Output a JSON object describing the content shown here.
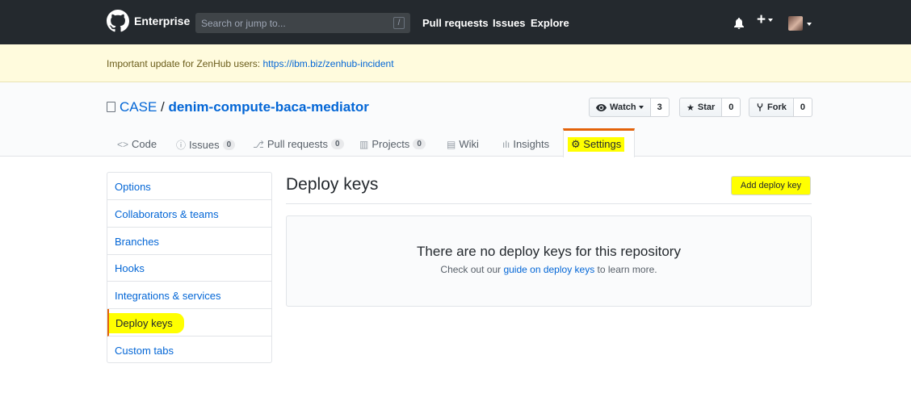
{
  "header": {
    "brand": "Enterprise",
    "search_placeholder": "Search or jump to...",
    "slash_hint": "/",
    "nav": [
      "Pull requests",
      "Issues",
      "Explore"
    ],
    "plus": "+"
  },
  "banner": {
    "text": "Important update for ZenHub users: ",
    "link": "https://ibm.biz/zenhub-incident"
  },
  "repo": {
    "owner": "CASE",
    "separator": " / ",
    "name": "denim-compute-baca-mediator",
    "watch_label": "Watch",
    "watch_count": "3",
    "star_label": "Star",
    "star_count": "0",
    "fork_label": "Fork",
    "fork_count": "0"
  },
  "tabs": {
    "code": "Code",
    "issues": "Issues",
    "issues_count": "0",
    "pulls": "Pull requests",
    "pulls_count": "0",
    "projects": "Projects",
    "projects_count": "0",
    "wiki": "Wiki",
    "insights": "Insights",
    "settings": "Settings"
  },
  "sidebar": {
    "items": [
      {
        "label": "Options"
      },
      {
        "label": "Collaborators & teams"
      },
      {
        "label": "Branches"
      },
      {
        "label": "Hooks"
      },
      {
        "label": "Integrations & services"
      },
      {
        "label": "Deploy keys"
      },
      {
        "label": "Custom tabs"
      }
    ]
  },
  "main": {
    "title": "Deploy keys",
    "add_button": "Add deploy key",
    "blank_heading": "There are no deploy keys for this repository",
    "blank_text_before": "Check out our ",
    "blank_link": "guide on deploy keys",
    "blank_text_after": " to learn more."
  },
  "colors": {
    "header_bg": "#24292e",
    "banner_bg": "#fffbdd",
    "link": "#0366d6",
    "highlight": "#ffff00",
    "accent": "#e36209"
  }
}
